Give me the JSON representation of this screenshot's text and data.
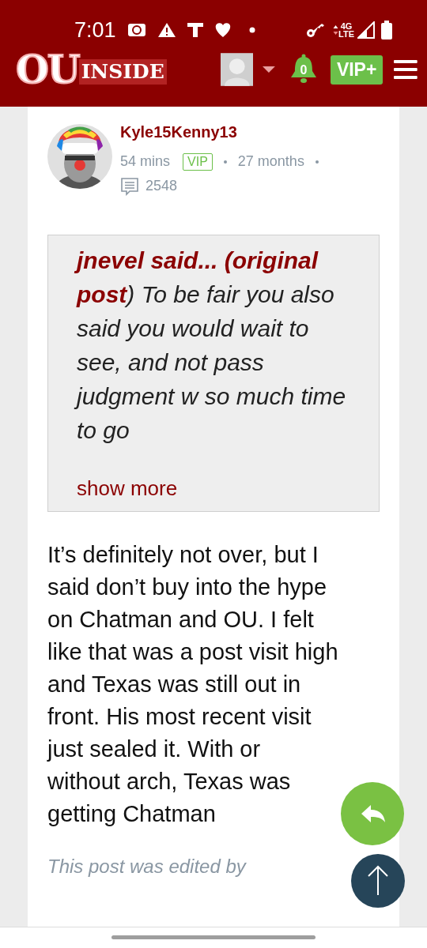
{
  "status_bar": {
    "time": "7:01",
    "network": "4G LTE"
  },
  "header": {
    "logo": {
      "initials": "OU",
      "word": "INSIDE"
    },
    "notifications": "0",
    "vip_button": "VIP+"
  },
  "post": {
    "author": "Kyle15Kenny13",
    "time": "54 mins",
    "badge": "VIP",
    "tenure": "27 months",
    "post_count": "2548",
    "quote": {
      "text": "**jnevel said... (original post**) To be fair you also said you would wait to see, and not pass judgment w so much time to go",
      "show_more": "show more"
    },
    "body": "It’s definitely not over, but I said don’t buy into the hype on Chatman and OU. I felt like that was a post visit high and Texas was still out in front. His most recent visit just sealed it. With or without arch, Texas was getting Chatman",
    "edited_note": "This post was edited by"
  }
}
